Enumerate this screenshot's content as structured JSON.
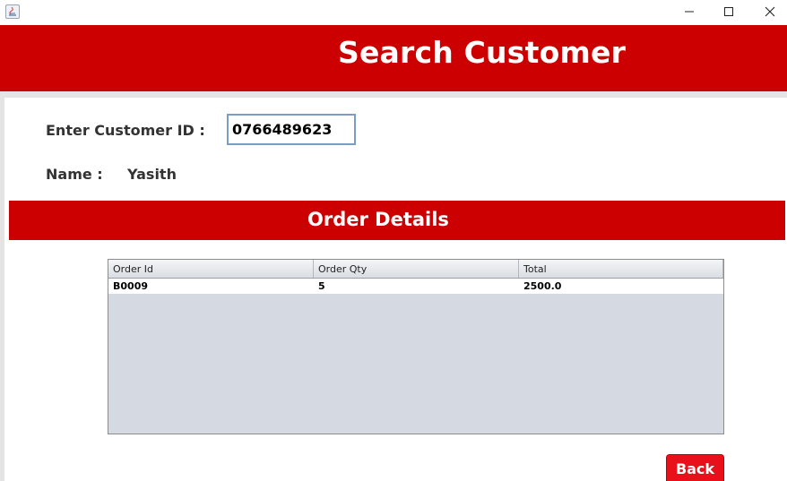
{
  "window": {
    "icon": "java-icon",
    "controls": [
      "minimize-icon",
      "maximize-icon",
      "close-icon"
    ]
  },
  "header": {
    "title": "Search Customer"
  },
  "form": {
    "customer_id_label": "Enter Customer ID :",
    "customer_id_value": "0766489623",
    "name_label": "Name :",
    "name_value": "Yasith"
  },
  "orders": {
    "section_title": "Order Details",
    "columns": [
      "Order Id",
      "Order Qty",
      "Total"
    ],
    "rows": [
      [
        "B0009",
        "5",
        "2500.0"
      ]
    ]
  },
  "actions": {
    "back_label": "Back"
  },
  "colors": {
    "header_bg": "#cc0000",
    "band_bg": "#cc0000",
    "back_button_bg": "#e8111b",
    "table_empty_bg": "#d5d9e2"
  }
}
